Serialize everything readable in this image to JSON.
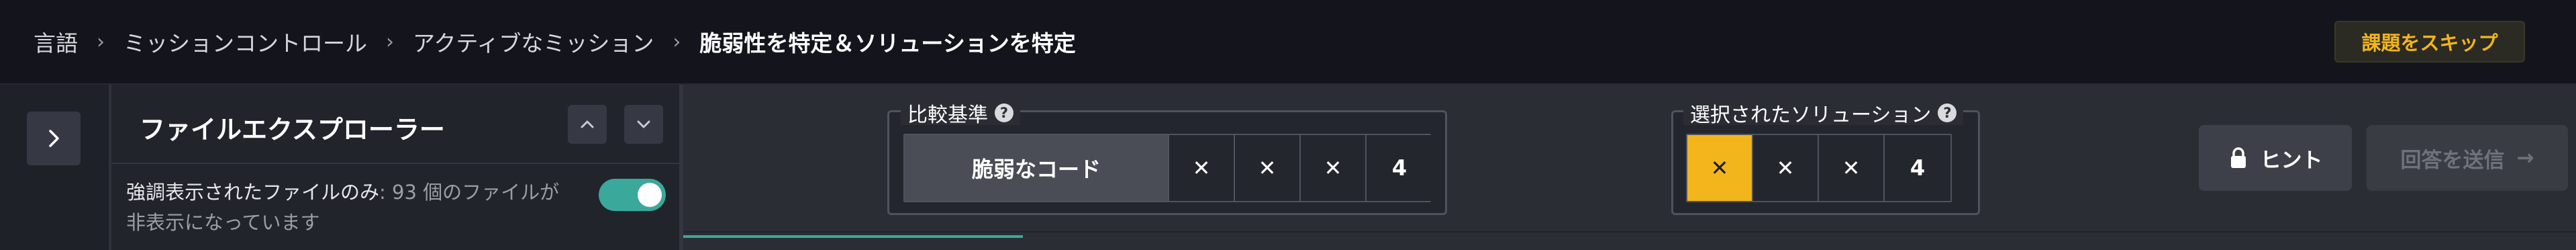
{
  "breadcrumb": {
    "items": [
      "言語",
      "ミッションコントロール",
      "アクティブなミッション",
      "脆弱性を特定＆ソリューションを特定"
    ],
    "separator": "›"
  },
  "header": {
    "skip_label": "課題をスキップ"
  },
  "explorer": {
    "title": "ファイルエクスプローラー",
    "filter_highlight": "強調表示",
    "filter_text": "されたファイルのみ",
    "filter_count_text": ": 93 個",
    "filter_tail": "のファイルが非表示になっています",
    "toggle_on": true
  },
  "comparison": {
    "legend": "比較基準",
    "help": "?",
    "cells": [
      "脆弱なコード",
      "✕",
      "✕",
      "✕",
      "4"
    ]
  },
  "selected": {
    "legend": "選択されたソリューション",
    "help": "?",
    "cells": [
      "✕",
      "✕",
      "✕",
      "4"
    ]
  },
  "actions": {
    "hint_label": "ヒント",
    "submit_label": "回答を送信",
    "submit_arrow": "→"
  },
  "colors": {
    "accent": "#f3b51c",
    "toggle": "#3aa89b",
    "background": "#1b1d24"
  }
}
